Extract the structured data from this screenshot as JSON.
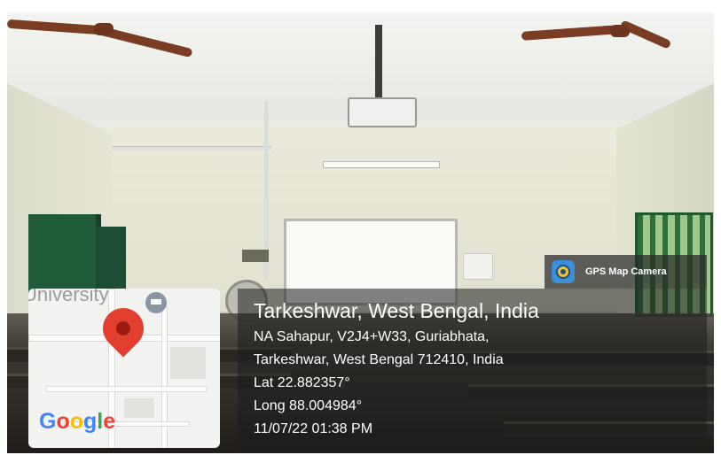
{
  "badge": {
    "icon": "gps-map-camera-icon",
    "label": "GPS Map Camera"
  },
  "location": {
    "title": "Tarkeshwar, West Bengal, India",
    "address_line1": "NA Sahapur, V2J4+W33, Guriabhata,",
    "address_line2": "Tarkeshwar, West Bengal 712410, India",
    "latitude": "Lat 22.882357°",
    "longitude": "Long 88.004984°",
    "timestamp": "11/07/22 01:38 PM"
  },
  "map": {
    "label": "University",
    "pin": "location-pin-icon",
    "logo": "Google",
    "logo_colors": [
      "#4285F4",
      "#EA4335",
      "#FBBC05",
      "#4285F4",
      "#34A853",
      "#EA4335"
    ]
  }
}
